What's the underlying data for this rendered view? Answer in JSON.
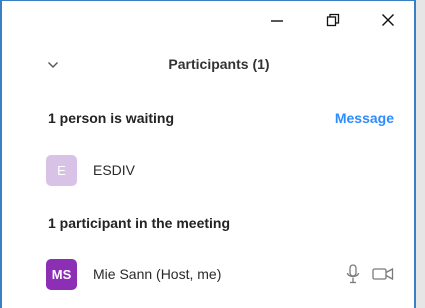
{
  "window_controls": {
    "minimize_icon": "minimize-icon",
    "restore_icon": "restore-icon",
    "close_icon": "close-icon"
  },
  "panel": {
    "title": "Participants (1)",
    "collapse_icon": "chevron-down-icon"
  },
  "waiting_section": {
    "title": "1 person is waiting",
    "message_label": "Message",
    "people": [
      {
        "initials": "E",
        "name": "ESDIV",
        "avatar_color": "#d8c3e6"
      }
    ]
  },
  "meeting_section": {
    "title": "1 participant in the meeting",
    "people": [
      {
        "initials": "MS",
        "name": "Mie Sann (Host, me)",
        "avatar_color": "#8c2fb5",
        "mic_icon": "microphone-icon",
        "video_icon": "video-camera-icon"
      }
    ]
  },
  "colors": {
    "window_border": "#3a7fc4",
    "link": "#2d8cff"
  }
}
